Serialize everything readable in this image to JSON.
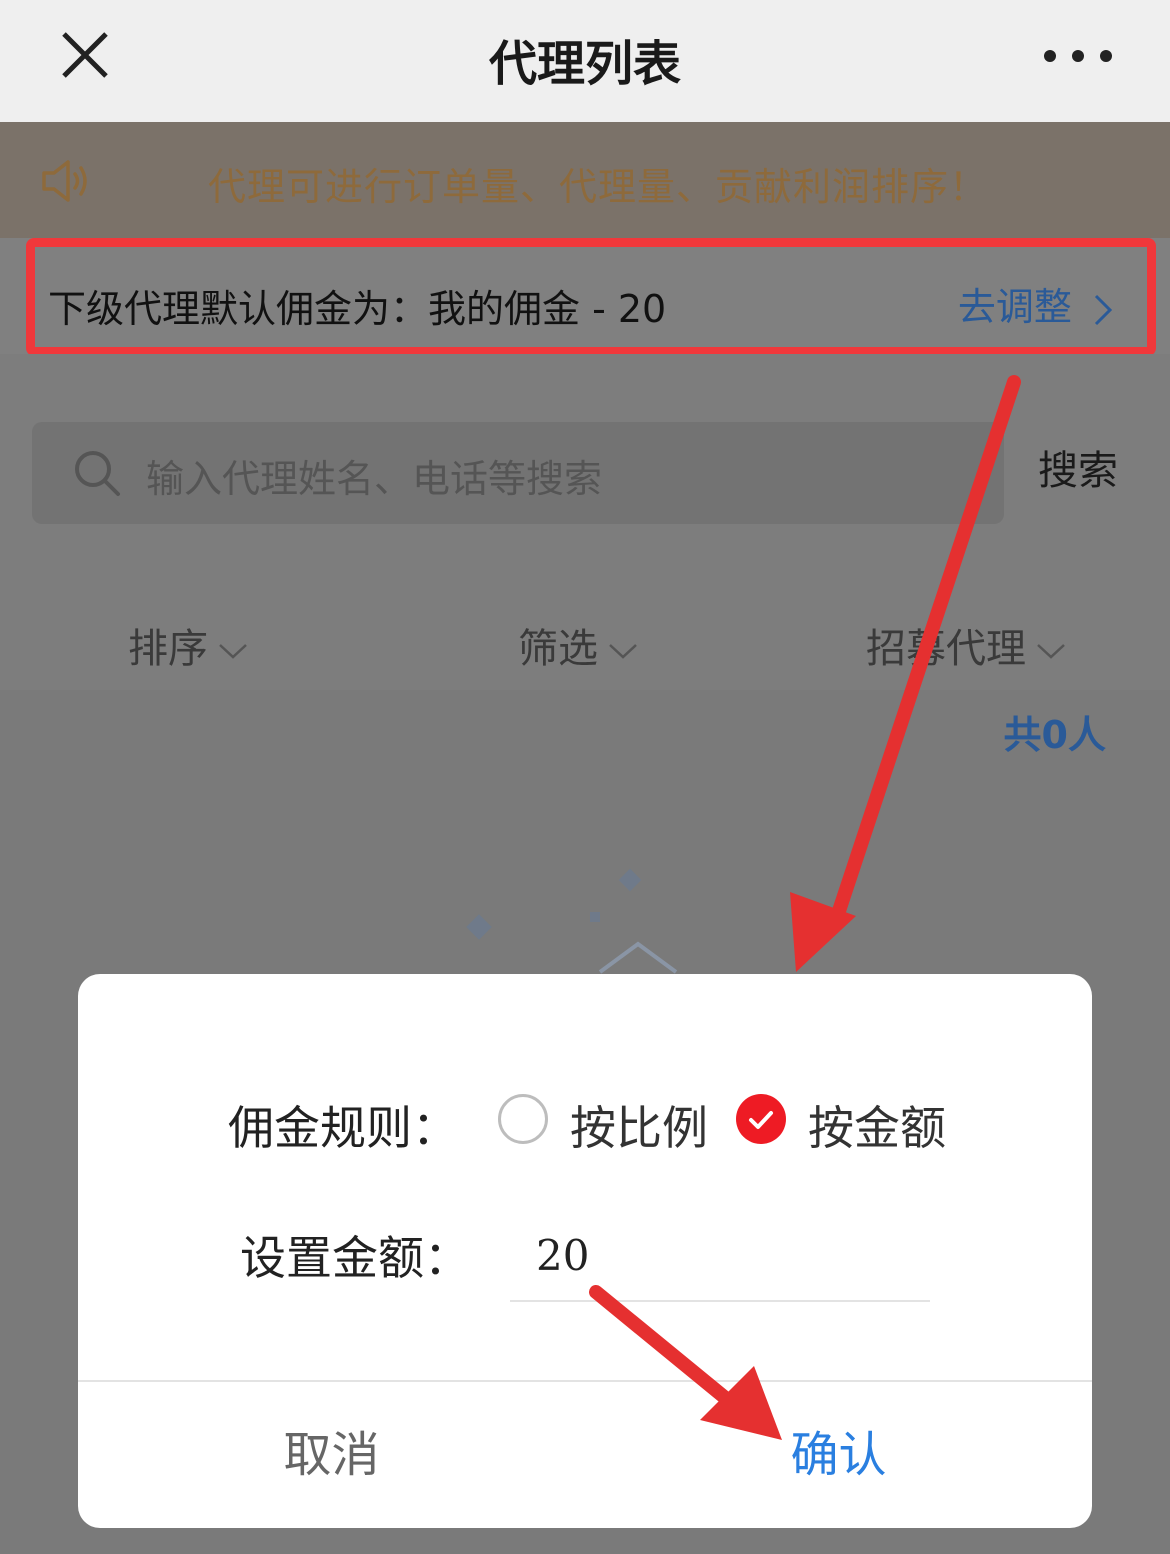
{
  "topbar": {
    "title": "代理列表"
  },
  "notice": {
    "text": "代理可进行订单量、代理量、贡献利润排序！"
  },
  "commission": {
    "label": "下级代理默认佣金为：我的佣金 - 20",
    "adjust": "去调整"
  },
  "search": {
    "placeholder": "输入代理姓名、电话等搜索",
    "button": "搜索"
  },
  "filters": [
    {
      "label": "排序"
    },
    {
      "label": "筛选"
    },
    {
      "label": "招募代理"
    }
  ],
  "count": "共0人",
  "dialog": {
    "rule_label": "佣金规则：",
    "options": [
      {
        "label": "按比例",
        "selected": false
      },
      {
        "label": "按金额",
        "selected": true
      }
    ],
    "amount_label": "设置金额：",
    "amount_value": "20",
    "cancel": "取消",
    "confirm": "确认"
  },
  "colors": {
    "accent_blue": "#2a7fe0",
    "highlight_red": "#f0383b",
    "radio_red": "#ee1b24"
  }
}
